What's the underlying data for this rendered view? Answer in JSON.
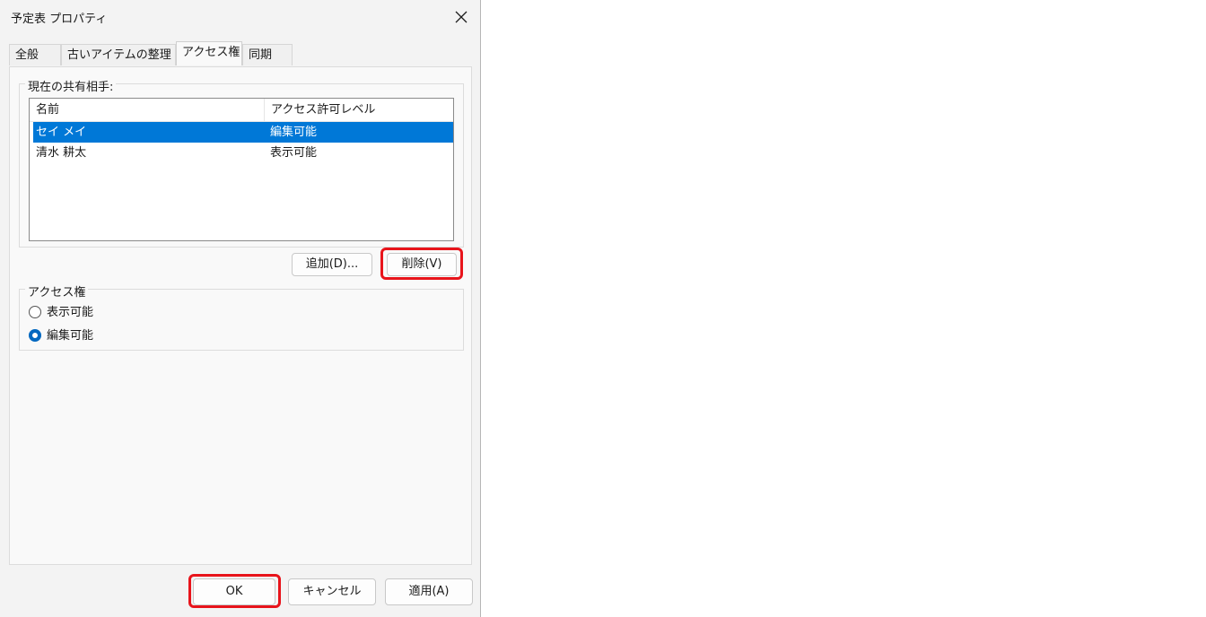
{
  "window": {
    "title": "予定表 プロパティ"
  },
  "tabs": [
    {
      "label": "全般"
    },
    {
      "label": "古いアイテムの整理"
    },
    {
      "label": "アクセス権"
    },
    {
      "label": "同期"
    }
  ],
  "active_tab": "アクセス権",
  "sharing": {
    "group_label": "現在の共有相手:",
    "columns": [
      "名前",
      "アクセス許可レベル"
    ],
    "rows": [
      {
        "name": "セイ メイ",
        "level": "編集可能",
        "selected": true
      },
      {
        "name": "清水 耕太",
        "level": "表示可能",
        "selected": false
      }
    ],
    "add_button": "追加(D)...",
    "remove_button": "削除(V)"
  },
  "access": {
    "group_label": "アクセス権",
    "options": [
      {
        "label": "表示可能",
        "checked": false
      },
      {
        "label": "編集可能",
        "checked": true
      }
    ]
  },
  "footer": {
    "ok": "OK",
    "cancel": "キャンセル",
    "apply": "適用(A)"
  },
  "colors": {
    "selection": "#0078d7",
    "highlight": "#e8141b",
    "radio_accent": "#0067c0"
  }
}
